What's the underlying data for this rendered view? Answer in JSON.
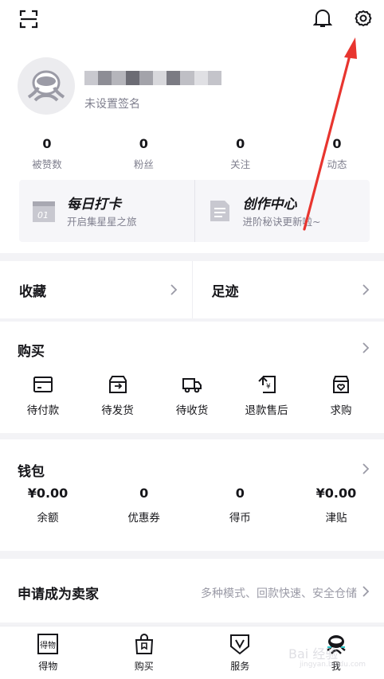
{
  "profile": {
    "signature": "未设置签名"
  },
  "stats": [
    {
      "value": "0",
      "label": "被赞数"
    },
    {
      "value": "0",
      "label": "粉丝"
    },
    {
      "value": "0",
      "label": "关注"
    },
    {
      "value": "0",
      "label": "动态"
    }
  ],
  "cards": [
    {
      "title": "每日打卡",
      "subtitle": "开启集星星之旅",
      "icon": "calendar-icon",
      "icon_text": "01"
    },
    {
      "title": "创作中心",
      "subtitle": "进阶秘诀更新啦~",
      "icon": "document-icon"
    }
  ],
  "quick_links": [
    {
      "label": "收藏"
    },
    {
      "label": "足迹"
    }
  ],
  "purchase": {
    "title": "购买",
    "items": [
      {
        "label": "待付款",
        "icon": "card-icon"
      },
      {
        "label": "待发货",
        "icon": "box-icon"
      },
      {
        "label": "待收货",
        "icon": "truck-icon"
      },
      {
        "label": "退款售后",
        "icon": "refund-icon"
      },
      {
        "label": "求购",
        "icon": "bag-heart-icon"
      }
    ]
  },
  "wallet": {
    "title": "钱包",
    "items": [
      {
        "value": "¥0.00",
        "label": "余额"
      },
      {
        "value": "0",
        "label": "优惠券"
      },
      {
        "value": "0",
        "label": "得币"
      },
      {
        "value": "¥0.00",
        "label": "津贴"
      }
    ]
  },
  "seller": {
    "title": "申请成为卖家",
    "subtitle": "多种模式、回款快速、安全仓储"
  },
  "tabbar": [
    {
      "label": "得物",
      "icon": "dewu-icon",
      "icon_text": "得物"
    },
    {
      "label": "购买",
      "icon": "shopping-bag-icon"
    },
    {
      "label": "服务",
      "icon": "shield-v-icon"
    },
    {
      "label": "我",
      "icon": "me-avatar-icon"
    }
  ],
  "watermark": {
    "brand": "Bai 经验",
    "url": "jingyan.baidu.com"
  },
  "colors": {
    "annotation_arrow": "#e8352f",
    "accent": "#16161a",
    "muted": "#7f7f8e",
    "background": "#f3f3f6"
  }
}
